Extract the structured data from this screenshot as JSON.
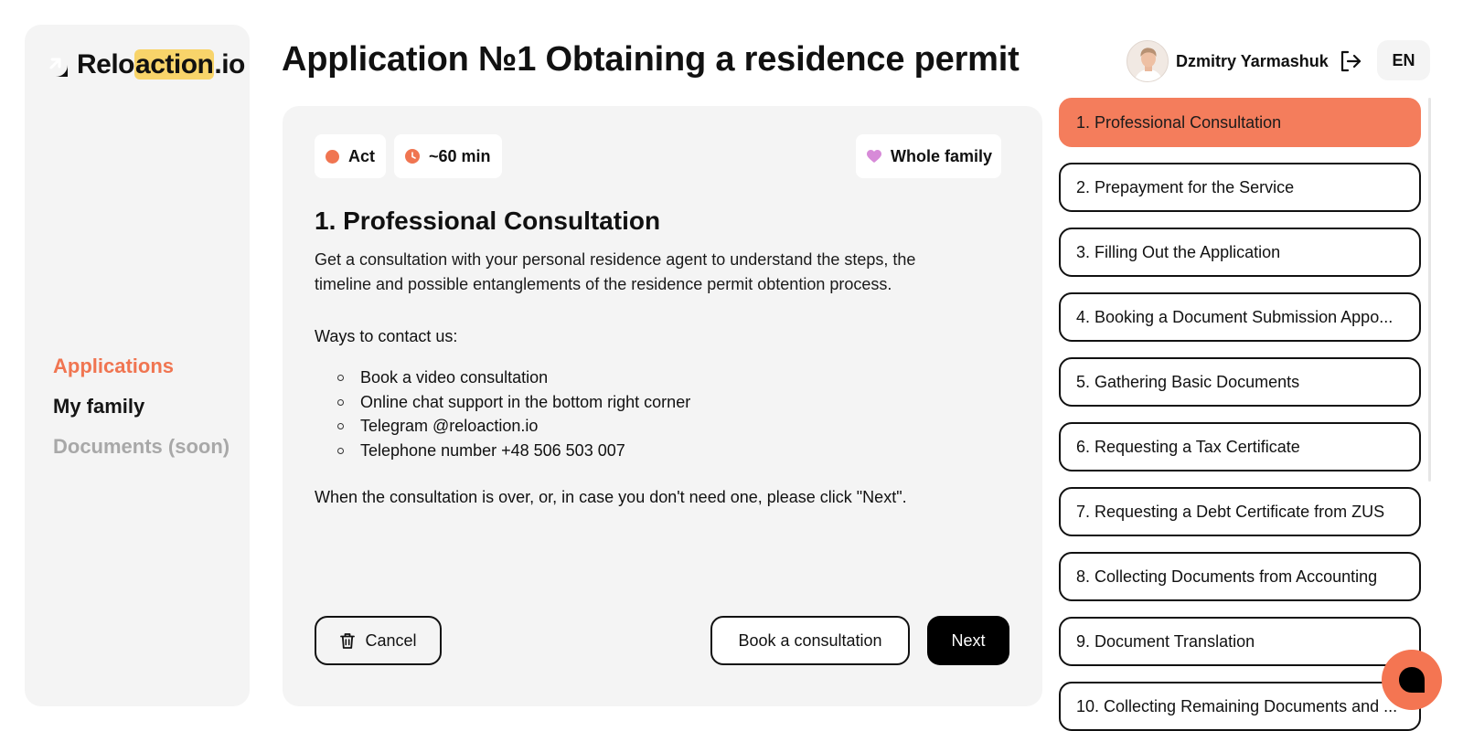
{
  "sidebar": {
    "logo": {
      "part1": "Relo",
      "highlight": "action",
      "part2": ".io"
    },
    "nav": [
      {
        "label": "Applications",
        "state": "active"
      },
      {
        "label": "My family",
        "state": "normal"
      },
      {
        "label": "Documents (soon)",
        "state": "disabled"
      }
    ]
  },
  "header": {
    "title": "Application №1 Obtaining a residence permit",
    "user_name": "Dzmitry Yarmashuk",
    "lang": "EN"
  },
  "card": {
    "tags": {
      "act": "Act",
      "time": "~60 min",
      "family": "Whole family"
    },
    "step_title": "1. Professional Consultation",
    "description": "Get a consultation with your personal residence agent to understand the steps, the timeline and possible entanglements of the residence permit obtention process.",
    "ways_label": "Ways to contact us:",
    "ways": [
      "Book a video consultation",
      "Online chat support in the bottom right corner",
      "Telegram @reloaction.io",
      "Telephone number +48 506 503 007"
    ],
    "note": "When the consultation is over, or, in case you don't need one, please click \"Next\".",
    "buttons": {
      "cancel": "Cancel",
      "book": "Book a consultation",
      "next": "Next"
    }
  },
  "steps": [
    {
      "label": "1. Professional Consultation",
      "active": true
    },
    {
      "label": "2. Prepayment for the Service",
      "active": false
    },
    {
      "label": "3. Filling Out the Application",
      "active": false
    },
    {
      "label": "4. Booking a Document Submission Appo...",
      "active": false
    },
    {
      "label": "5. Gathering Basic Documents",
      "active": false
    },
    {
      "label": "6. Requesting a Tax Certificate",
      "active": false
    },
    {
      "label": "7. Requesting a Debt Certificate from ZUS",
      "active": false
    },
    {
      "label": "8. Collecting Documents from Accounting",
      "active": false
    },
    {
      "label": "9. Document Translation",
      "active": false
    },
    {
      "label": "10. Collecting Remaining Documents and ...",
      "active": false
    }
  ],
  "colors": {
    "accent": "#f47d5c",
    "card_bg": "#f4f4f4",
    "highlight": "#f8d46a"
  },
  "icons": [
    "logo-mark-icon",
    "logout-icon",
    "clock-icon",
    "heart-icon",
    "trash-icon",
    "chat-icon"
  ]
}
